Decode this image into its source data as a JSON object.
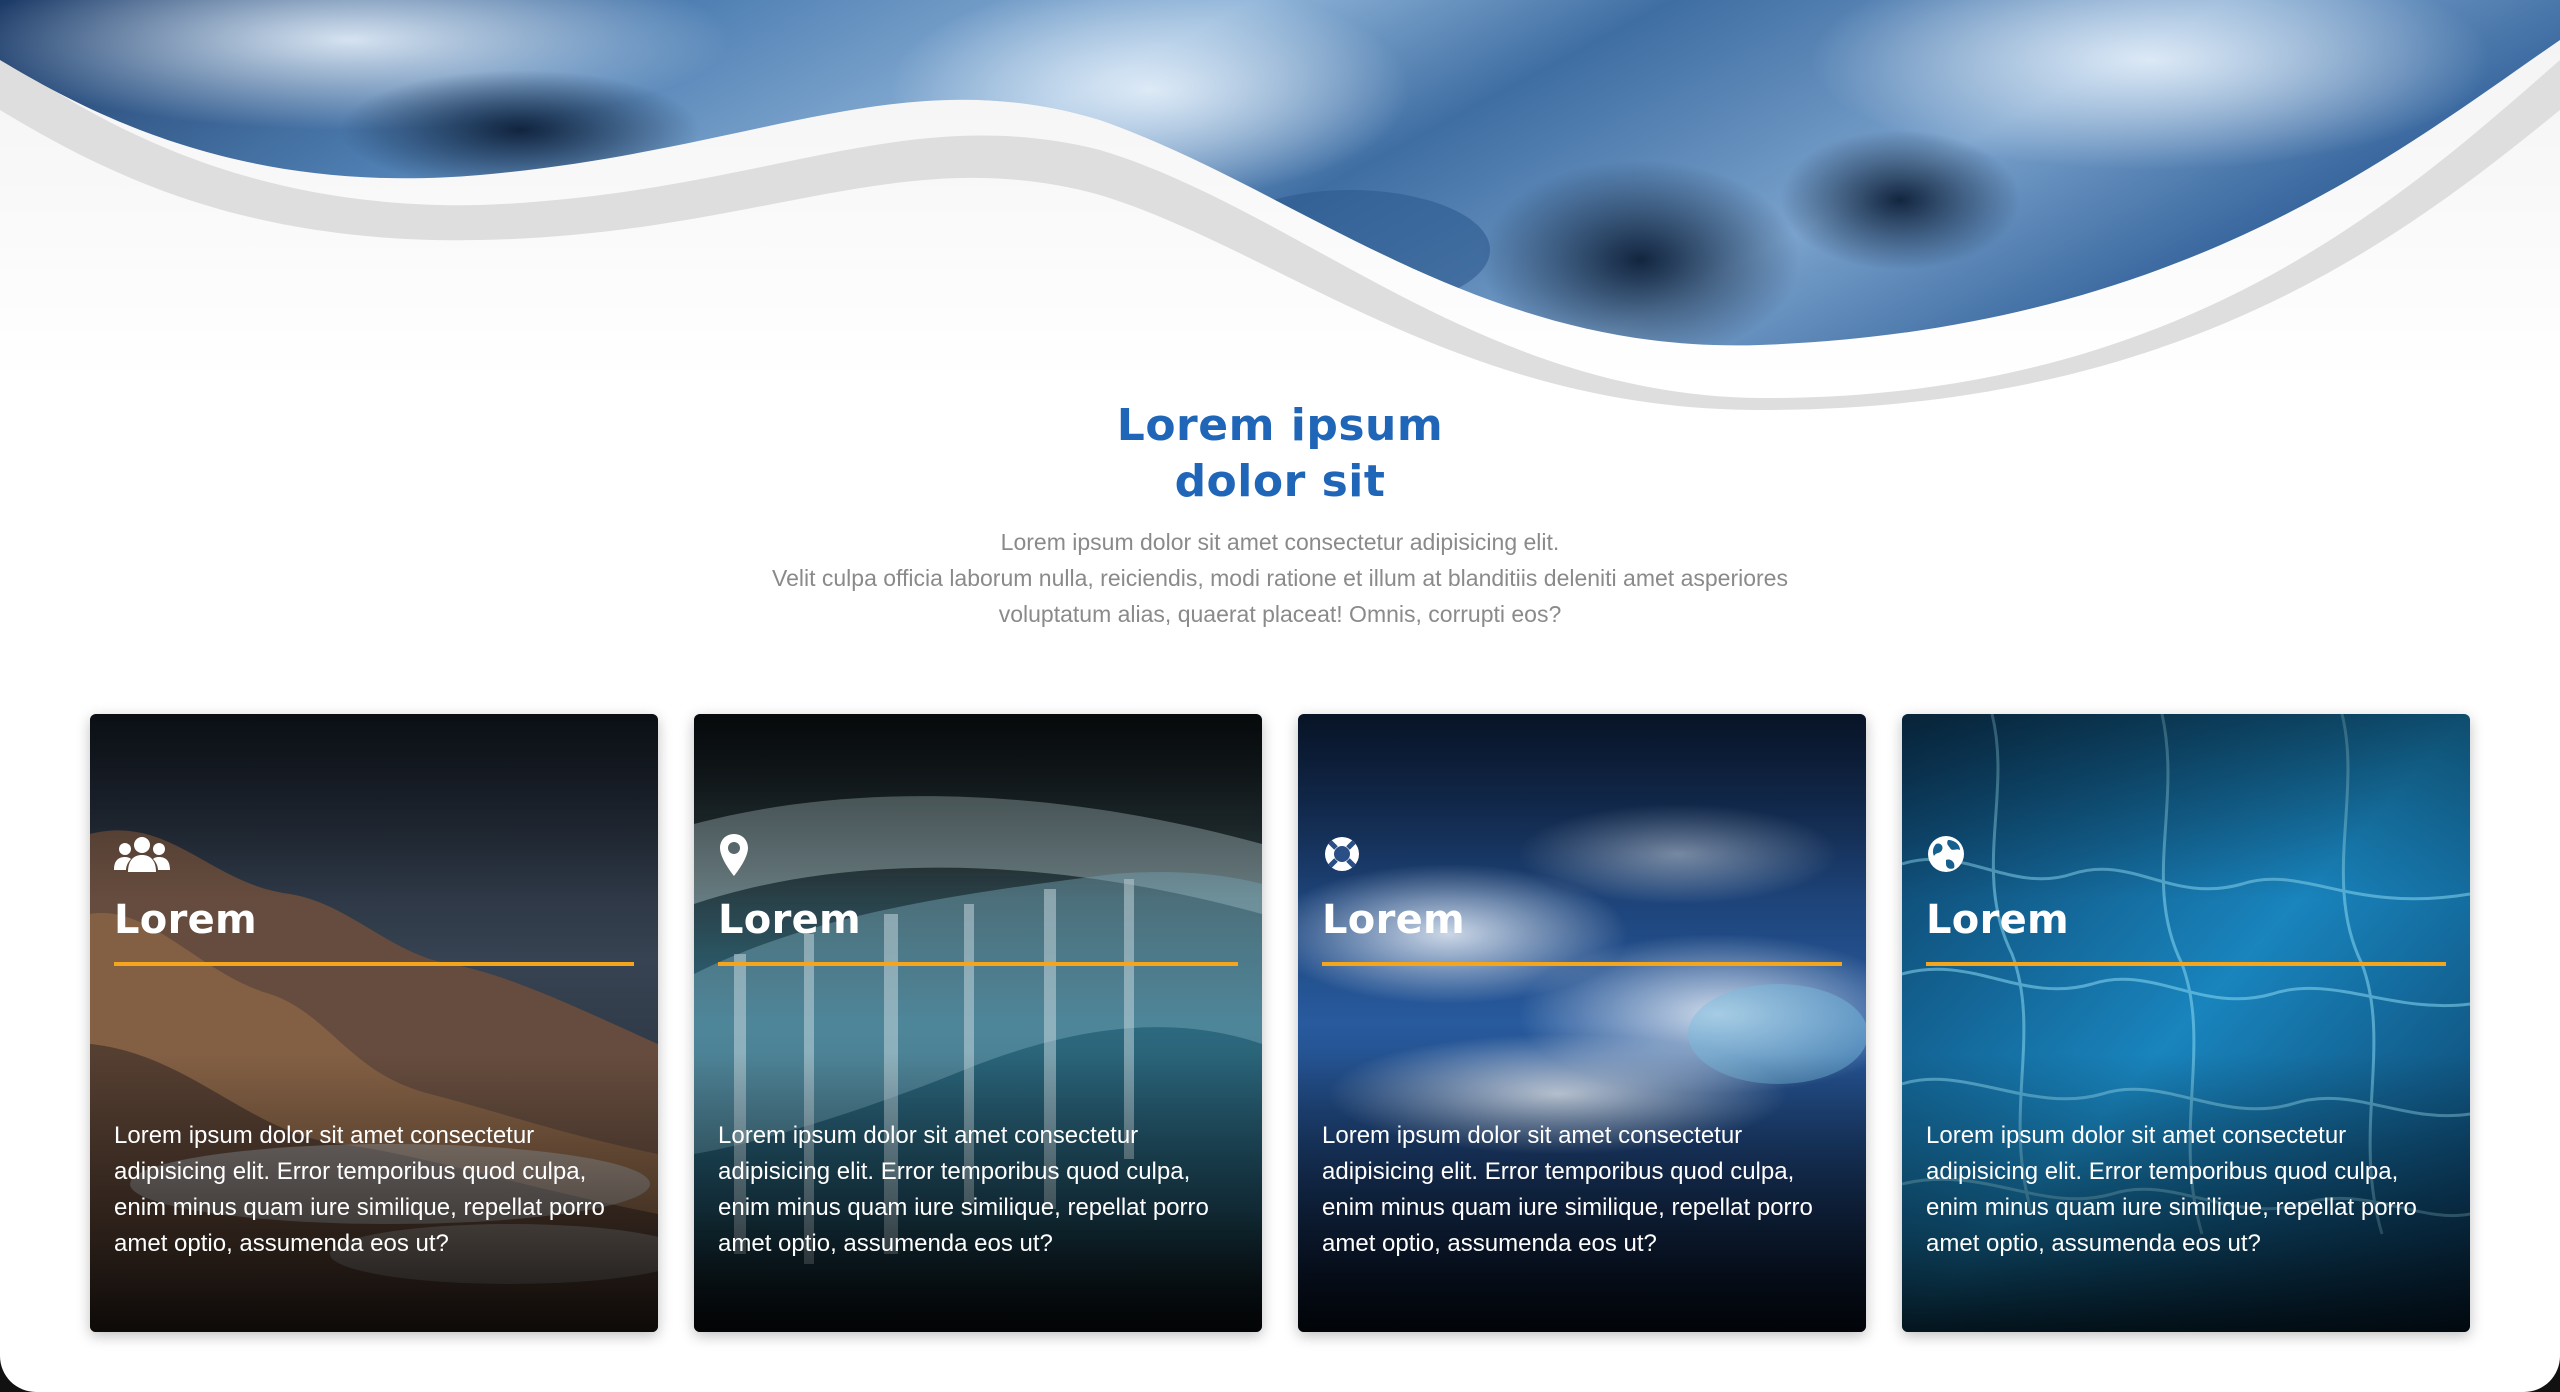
{
  "section": {
    "title_line1": "Lorem ipsum",
    "title_line2": "dolor sit",
    "desc_line1": "Lorem ipsum dolor sit amet consectetur adipisicing elit.",
    "desc_line2": "Velit culpa officia laborum nulla, reiciendis, modi ratione et illum at blanditiis deleniti amet asperiores",
    "desc_line3": "voluptatum alias, quaerat placeat! Omnis, corrupti eos?"
  },
  "cards": [
    {
      "icon": "users-icon",
      "title": "Lorem",
      "text": "Lorem ipsum dolor sit amet consectetur adipisicing elit. Error temporibus quod culpa, enim minus quam iure similique, repellat porro amet optio, assumenda eos ut?"
    },
    {
      "icon": "map-marker-icon",
      "title": "Lorem",
      "text": "Lorem ipsum dolor sit amet consectetur adipisicing elit. Error temporibus quod culpa, enim minus quam iure similique, repellat porro amet optio, assumenda eos ut?"
    },
    {
      "icon": "life-ring-icon",
      "title": "Lorem",
      "text": "Lorem ipsum dolor sit amet consectetur adipisicing elit. Error temporibus quod culpa, enim minus quam iure similique, repellat porro amet optio, assumenda eos ut?"
    },
    {
      "icon": "globe-icon",
      "title": "Lorem",
      "text": "Lorem ipsum dolor sit amet consectetur adipisicing elit. Error temporibus quod culpa, enim minus quam iure similique, repellat porro amet optio, assumenda eos ut?"
    }
  ],
  "colors": {
    "title_blue": "#1f66b8",
    "accent_orange": "#f2a51d",
    "desc_gray": "#8a8a8a"
  }
}
